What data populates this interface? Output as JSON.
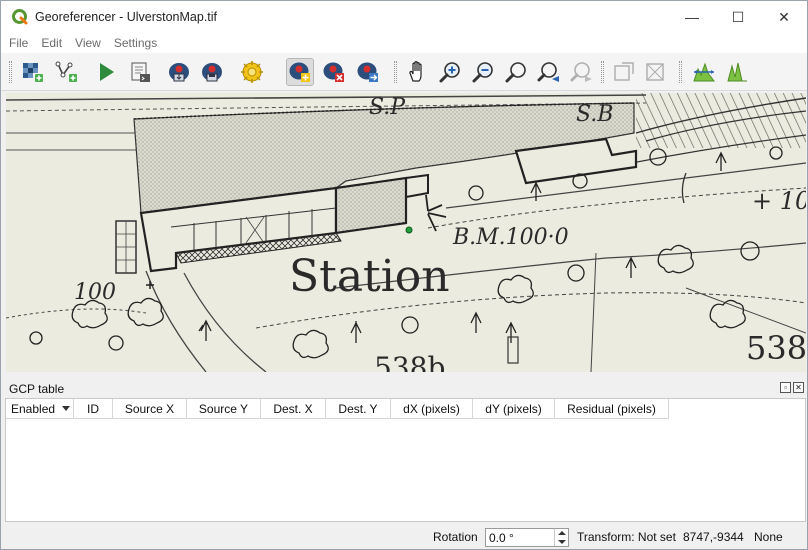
{
  "window": {
    "title": "Georeferencer - UlverstonMap.tif",
    "minimize_glyph": "—",
    "maximize_glyph": "☐",
    "close_glyph": "✕"
  },
  "menu": [
    "File",
    "Edit",
    "View",
    "Settings"
  ],
  "toolbar": {
    "icons": [
      "open-raster-icon",
      "open-gcp-points-icon",
      "start-georeferencing-icon",
      "generate-gdal-script-icon",
      "load-gcp-points-icon",
      "save-gcp-points-icon",
      "transformation-settings-icon",
      "add-point-icon",
      "delete-point-icon",
      "move-gcp-point-icon",
      "pan-icon",
      "zoom-in-icon",
      "zoom-out-icon",
      "zoom-to-layer-icon",
      "zoom-last-icon",
      "zoom-next-icon",
      "link-georeferencer-to-qgis-icon",
      "link-qgis-to-georeferencer-icon",
      "full-histogram-stretch-icon",
      "local-histogram-stretch-icon"
    ],
    "active_tool": "add-point-icon"
  },
  "map": {
    "labels": {
      "sp": "S.P",
      "sb": "S.B",
      "bm": "B.M.100·0",
      "station": "Station",
      "height": "100",
      "plus_right": "+ 10",
      "parcel_538b": "538b",
      "parcel_538": "538"
    },
    "gcp_marker_color": "#1f9e3a"
  },
  "gcp_table": {
    "title": "GCP table",
    "columns": [
      "Enabled",
      "ID",
      "Source X",
      "Source Y",
      "Dest. X",
      "Dest. Y",
      "dX (pixels)",
      "dY (pixels)",
      "Residual (pixels)"
    ],
    "rows": []
  },
  "statusbar": {
    "rotation_label": "Rotation",
    "rotation_value": "0.0 °",
    "transform": "Transform: Not set",
    "coordinates": "8747,-9344",
    "crs": "None"
  }
}
